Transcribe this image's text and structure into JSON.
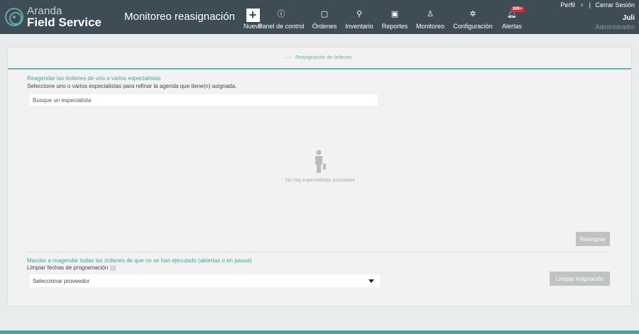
{
  "brand": {
    "line1": "Aranda",
    "line2": "Field Service"
  },
  "header": {
    "page_title": "Monitoreo reasignación"
  },
  "nav": [
    {
      "label": "Nueva",
      "icon": "plus-icon"
    },
    {
      "label": "Panel de control",
      "icon": "info-circle-icon"
    },
    {
      "label": "Órdenes",
      "icon": "calendar-icon"
    },
    {
      "label": "Inventario",
      "icon": "cart-icon"
    },
    {
      "label": "Reportes",
      "icon": "report-icon"
    },
    {
      "label": "Monitoreo",
      "icon": "person-icon"
    },
    {
      "label": "Configuración",
      "icon": "gear-icon"
    },
    {
      "label": "Alertas",
      "icon": "bell-icon",
      "badge": "999+"
    }
  ],
  "user": {
    "profile_link": "Perfil",
    "logout_link": "Cerrar Sesión",
    "separator": "|",
    "name": "Juli",
    "role": "Administrador"
  },
  "tabs": {
    "active": "Reasignación de órdenes"
  },
  "section1": {
    "title": "Reagendar las órdenes de uno o varios especialistas",
    "subtitle": "Seleccione uno o varios especialistas para refinar la agenda que tiene(n) asignada.",
    "search_placeholder": "Busque un especialista",
    "empty_message": "No hay especialistas asociados",
    "reassign_button": "Reasignar"
  },
  "section2": {
    "title": "Mandar a reagendar todas las órdenes de que no se han ejecutado (abiertas o en pausa)",
    "clear_dates_label": "Limpiar fechas de programación",
    "provider_select": "Seleccionar proveedor",
    "clear_assignment_button": "Limpiar Asignación"
  },
  "colors": {
    "header_bg": "#3e4c55",
    "accent": "#3aa7a0",
    "button_disabled": "#c0c3c3",
    "badge": "#e02a2a"
  }
}
